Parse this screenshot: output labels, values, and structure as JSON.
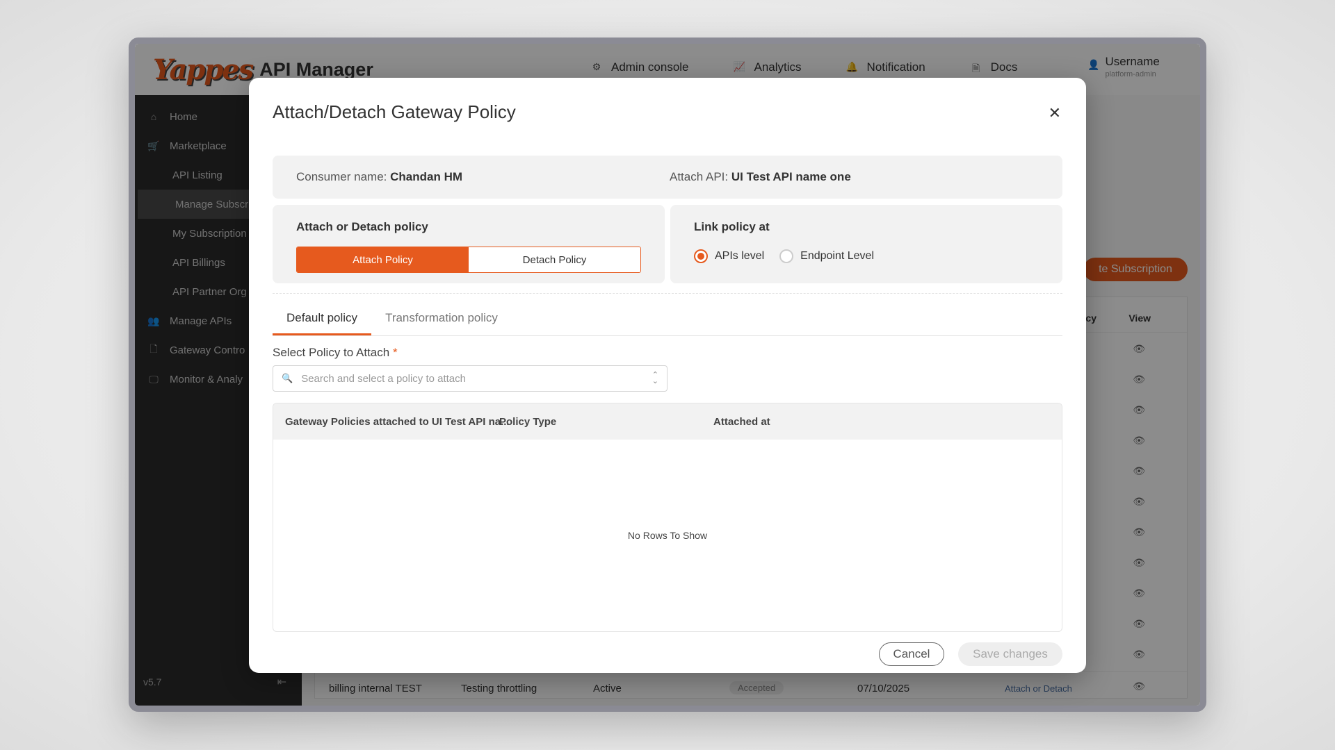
{
  "app": {
    "logo": "Yappes",
    "title": "API Manager",
    "version": "v5.7"
  },
  "top_nav": [
    {
      "label": "Admin console",
      "icon": "gear-icon"
    },
    {
      "label": "Analytics",
      "icon": "chart-icon"
    },
    {
      "label": "Notification",
      "icon": "bell-icon"
    },
    {
      "label": "Docs",
      "icon": "document-icon"
    }
  ],
  "user": {
    "name": "Username",
    "role": "platform-admin"
  },
  "sidebar": {
    "items": [
      {
        "label": "Home",
        "icon": "home-icon"
      },
      {
        "label": "Marketplace",
        "icon": "cart-icon"
      },
      {
        "label": "API Listing"
      },
      {
        "label": "Manage Subscri"
      },
      {
        "label": "My Subscription"
      },
      {
        "label": "API Billings"
      },
      {
        "label": "API Partner Org"
      },
      {
        "label": "Manage APIs",
        "icon": "users-icon"
      },
      {
        "label": "Gateway Contro",
        "icon": "file-icon"
      },
      {
        "label": "Monitor & Analy",
        "icon": "monitor-icon"
      }
    ]
  },
  "background": {
    "create_button": "te Subscription",
    "columns": [
      "cy",
      "View"
    ],
    "last_row": {
      "name": "billing internal TEST",
      "description": "Testing throttling",
      "status": "Active",
      "approval": "Accepted",
      "date": "07/10/2025",
      "action": "Attach or Detach"
    }
  },
  "modal": {
    "title": "Attach/Detach Gateway Policy",
    "consumer_label": "Consumer name:",
    "consumer_value": "Chandan HM",
    "api_label": "Attach API:",
    "api_value": "UI Test API name one",
    "attach_panel_title": "Attach or Detach policy",
    "attach_button": "Attach Policy",
    "detach_button": "Detach Policy",
    "link_panel_title": "Link policy at",
    "link_options": [
      {
        "label": "APIs level",
        "selected": true
      },
      {
        "label": "Endpoint Level",
        "selected": false
      }
    ],
    "tabs": [
      {
        "label": "Default policy",
        "active": true
      },
      {
        "label": "Transformation policy",
        "active": false
      }
    ],
    "select_label": "Select Policy to Attach",
    "required_mark": "*",
    "select_placeholder": "Search and select a policy to attach",
    "grid_columns": [
      "Gateway Policies attached to UI Test API na...",
      "Policy Type",
      "Attached at"
    ],
    "grid_empty": "No Rows To Show",
    "cancel_button": "Cancel",
    "save_button": "Save changes"
  },
  "colors": {
    "accent": "#e65a1e",
    "sidebar_bg": "#2b2b2b",
    "panel_bg": "#f2f2f2"
  }
}
